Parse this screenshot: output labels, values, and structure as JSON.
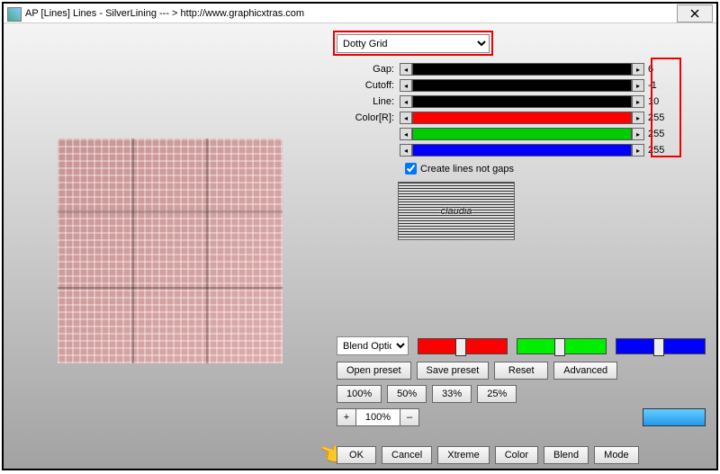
{
  "title": "AP [Lines]  Lines - SilverLining    --- >  http://www.graphicxtras.com",
  "preset": {
    "selected": "Dotty Grid"
  },
  "params": {
    "gap": {
      "label": "Gap:",
      "value": "6"
    },
    "cutoff": {
      "label": "Cutoff:",
      "value": "-1"
    },
    "line": {
      "label": "Line:",
      "value": "10"
    },
    "colorR": {
      "label": "Color[R]:",
      "value": "255"
    },
    "colorG": {
      "label": "",
      "value": "255"
    },
    "colorB": {
      "label": "",
      "value": "255"
    }
  },
  "createLines": {
    "label": "Create lines not gaps",
    "checked": true
  },
  "logo": "claudia",
  "blendOptions": {
    "label": "Blend Optic"
  },
  "buttons": {
    "openPreset": "Open preset",
    "savePreset": "Save preset",
    "reset": "Reset",
    "advanced": "Advanced",
    "p100": "100%",
    "p50": "50%",
    "p33": "33%",
    "p25": "25%",
    "ok": "OK",
    "cancel": "Cancel",
    "xtreme": "Xtreme",
    "color": "Color",
    "blend": "Blend",
    "mode": "Mode"
  },
  "zoom": {
    "plus": "+",
    "value": "100%",
    "minus": "–"
  }
}
